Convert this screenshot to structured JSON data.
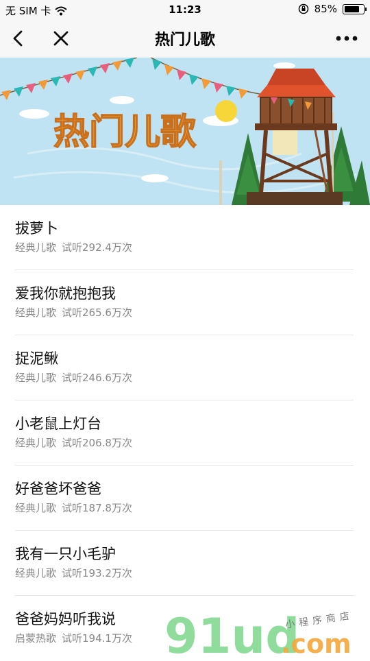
{
  "status_bar": {
    "carrier": "无 SIM 卡",
    "time": "11:23",
    "battery": "85%"
  },
  "nav": {
    "title": "热门儿歌"
  },
  "banner": {
    "title": "热门儿歌"
  },
  "songs": [
    {
      "title": "拔萝卜",
      "category": "经典儿歌",
      "plays": "试听292.4万次"
    },
    {
      "title": "爱我你就抱抱我",
      "category": "经典儿歌",
      "plays": "试听265.6万次"
    },
    {
      "title": "捉泥鳅",
      "category": "经典儿歌",
      "plays": "试听246.6万次"
    },
    {
      "title": "小老鼠上灯台",
      "category": "经典儿歌",
      "plays": "试听206.8万次"
    },
    {
      "title": "好爸爸坏爸爸",
      "category": "经典儿歌",
      "plays": "试听187.8万次"
    },
    {
      "title": "我有一只小毛驴",
      "category": "经典儿歌",
      "plays": "试听193.2万次"
    },
    {
      "title": "爸爸妈妈听我说",
      "category": "启蒙热歌",
      "plays": "试听194.1万次"
    }
  ],
  "watermark": {
    "logo": "91ud",
    "domain": ".com",
    "tagline": "小程序商店"
  },
  "colors": {
    "sky": "#bfe3f2",
    "banner_title": "#f5a733",
    "tower": "#7a4426",
    "roof": "#e0532d",
    "tree": "#2f7a36",
    "watermark_green": "#7cd68c",
    "watermark_orange": "#f4a73a"
  }
}
